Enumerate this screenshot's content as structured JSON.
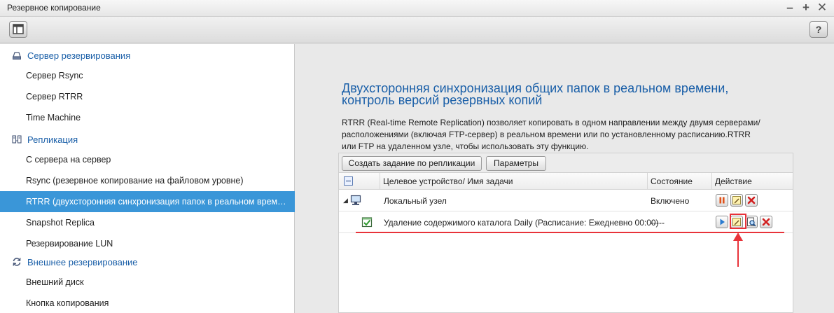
{
  "window": {
    "title": "Резервное копирование",
    "controls": [
      "minimize-icon",
      "maximize-icon",
      "close-icon"
    ]
  },
  "toolbar": {
    "left_icon": "panel-icon",
    "help_label": "?"
  },
  "sidebar": {
    "sections": [
      {
        "label": "Сервер резервирования",
        "icon": "backup-server-icon",
        "items": [
          {
            "label": "Сервер Rsync"
          },
          {
            "label": "Сервер RTRR"
          },
          {
            "label": "Time Machine"
          }
        ]
      },
      {
        "label": "Репликация",
        "icon": "replication-icon",
        "items": [
          {
            "label": "С сервера на сервер"
          },
          {
            "label": "Rsync (резервное копирование на файловом уровне)"
          },
          {
            "label": "RTRR (двухсторонняя синхронизация папок в реальном времени)",
            "active": true
          },
          {
            "label": "Snapshot Replica"
          },
          {
            "label": "Резервирование LUN"
          }
        ]
      },
      {
        "label": "Внешнее резервирование",
        "icon": "sync-arrows-icon",
        "items": [
          {
            "label": "Внешний диск"
          },
          {
            "label": "Кнопка копирования"
          }
        ]
      }
    ]
  },
  "main": {
    "heading": "Двухсторонняя синхронизация общих папок в реальном времени, контроль версий резервных копий",
    "description": "RTRR (Real-time Remote Replication) позволяет копировать в одном направлении между двумя серверами/расположениями (включая FTP-сервер) в реальном времени или по установленному расписанию.RTRR или FTP на удаленном узле, чтобы использовать эту функцию.",
    "buttons": {
      "create": "Создать задание по репликации",
      "params": "Параметры"
    },
    "table": {
      "headers": {
        "target": "Целевое устройство/ Имя задачи",
        "status": "Состояние",
        "action": "Действие"
      },
      "rows": [
        {
          "name": "Локальный узел",
          "status": "Включено",
          "icon": "computer-icon",
          "actions": [
            "pause-icon",
            "edit-icon",
            "delete-icon"
          ]
        },
        {
          "name": "Удаление содержимого каталога Daily (Расписание: Ежедневно 00:00)",
          "status": "-----",
          "icon": "task-check-icon",
          "actions": [
            "play-icon",
            "edit-icon",
            "log-search-icon",
            "delete-icon"
          ]
        }
      ]
    }
  },
  "colors": {
    "accent_blue": "#1a5fa8",
    "selected_row": "#3a96d8",
    "annotation_red": "#e8333a"
  }
}
